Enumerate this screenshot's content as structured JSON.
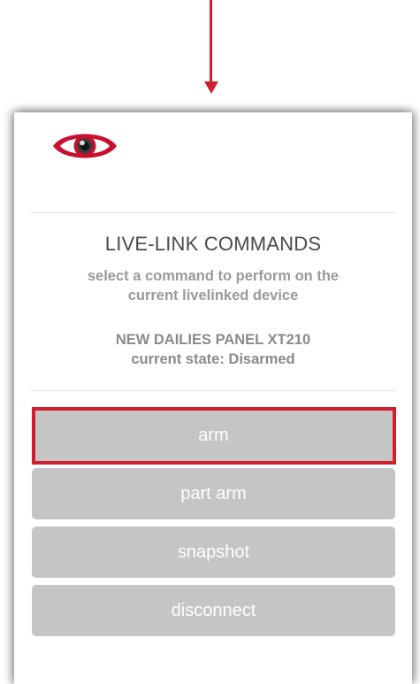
{
  "annotation": {
    "color": "#d0202e"
  },
  "app": {
    "logo_icon": "eye-icon",
    "brand_color": "#c8102e"
  },
  "commands": {
    "title": "LIVE-LINK COMMANDS",
    "subtitle_line1": "select a command to perform on the",
    "subtitle_line2": "current livelinked device",
    "device_name": "NEW DAILIES PANEL XT210",
    "device_state": "current state: Disarmed"
  },
  "buttons": [
    {
      "label": "arm",
      "highlighted": true
    },
    {
      "label": "part arm",
      "highlighted": false
    },
    {
      "label": "snapshot",
      "highlighted": false
    },
    {
      "label": "disconnect",
      "highlighted": false
    }
  ],
  "colors": {
    "button_bg": "#c5c5c5",
    "button_text": "#ffffff",
    "title_text": "#4a4a4a",
    "subtitle_text": "#9a9a9a"
  }
}
